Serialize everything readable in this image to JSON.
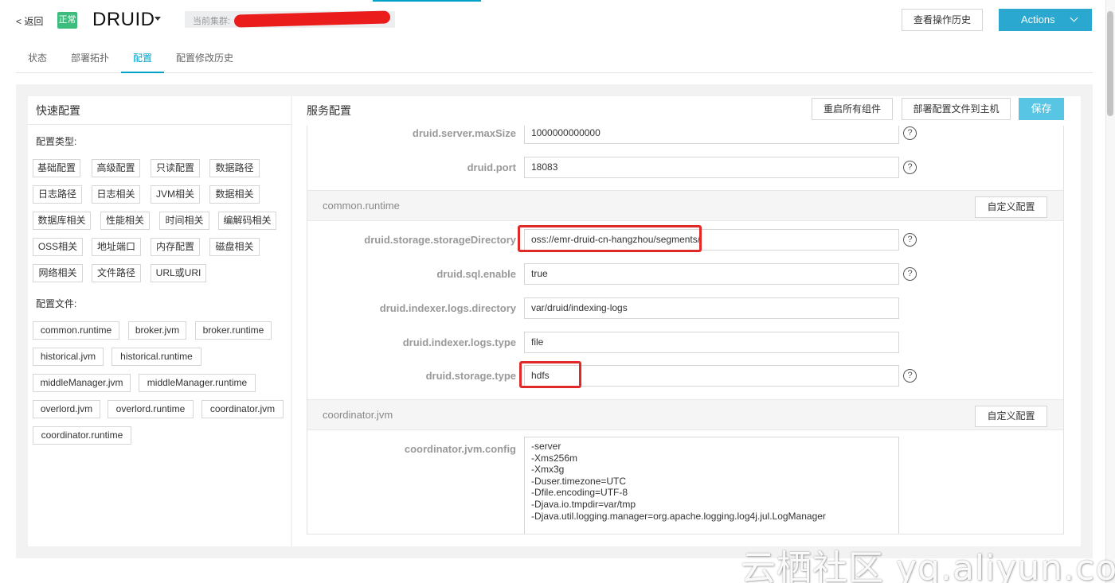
{
  "header": {
    "back_label": "< 返回",
    "status_label": "正常",
    "service_name": "DRUID",
    "cluster_label": "当前集群:",
    "history_button": "查看操作历史",
    "actions_button": "Actions"
  },
  "tabs": [
    {
      "label": "状态"
    },
    {
      "label": "部署拓扑"
    },
    {
      "label": "配置",
      "active": true
    },
    {
      "label": "配置修改历史"
    }
  ],
  "quick_config": {
    "title": "快速配置",
    "types_label": "配置类型:",
    "types": [
      "基础配置",
      "高级配置",
      "只读配置",
      "数据路径",
      "日志路径",
      "日志相关",
      "JVM相关",
      "数据相关",
      "数据库相关",
      "性能相关",
      "时间相关",
      "编解码相关",
      "OSS相关",
      "地址端口",
      "内存配置",
      "磁盘相关",
      "网络相关",
      "文件路径",
      "URL或URI"
    ],
    "files_label": "配置文件:",
    "files": [
      "common.runtime",
      "broker.jvm",
      "broker.runtime",
      "historical.jvm",
      "historical.runtime",
      "middleManager.jvm",
      "middleManager.runtime",
      "overlord.jvm",
      "overlord.runtime",
      "coordinator.jvm",
      "coordinator.runtime"
    ]
  },
  "service_config": {
    "title": "服务配置",
    "restart_button": "重启所有组件",
    "deploy_button": "部署配置文件到主机",
    "save_button": "保存",
    "custom_button": "自定义配置",
    "help_symbol": "?",
    "pre_props": [
      {
        "key": "druid.server.maxSize",
        "value": "1000000000000",
        "help": true
      },
      {
        "key": "druid.port",
        "value": "18083",
        "help": true
      }
    ],
    "sections": [
      {
        "title": "common.runtime",
        "props": [
          {
            "key": "druid.storage.storageDirectory",
            "value": "oss://emr-druid-cn-hangzhou/segments/",
            "help": true,
            "highlighted": true
          },
          {
            "key": "druid.sql.enable",
            "value": "true",
            "help": true
          },
          {
            "key": "druid.indexer.logs.directory",
            "value": "var/druid/indexing-logs",
            "help": false
          },
          {
            "key": "druid.indexer.logs.type",
            "value": "file",
            "help": false
          },
          {
            "key": "druid.storage.type",
            "value": "hdfs",
            "help": true,
            "highlighted": true
          }
        ]
      },
      {
        "title": "coordinator.jvm",
        "props": [
          {
            "key": "coordinator.jvm.config",
            "lines": [
              "-server",
              "-Xms256m",
              "-Xmx3g",
              "-Duser.timezone=UTC",
              "-Dfile.encoding=UTF-8",
              "-Djava.io.tmpdir=var/tmp",
              "-Djava.util.logging.manager=org.apache.logging.log4j.jul.LogManager"
            ]
          }
        ]
      }
    ]
  },
  "watermark": "云栖社区 yq.aliyun.com",
  "colors": {
    "accent": "#00a2ca",
    "actions": "#2aa8cf",
    "save": "#57c5e3",
    "status_ok": "#3dbd7d",
    "highlight": "#e02a2a"
  }
}
